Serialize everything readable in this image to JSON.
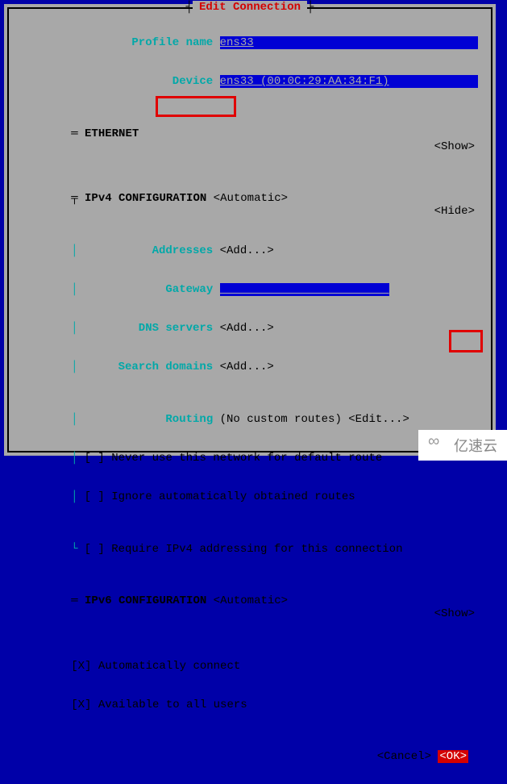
{
  "dialog": {
    "title": "Edit Connection"
  },
  "profile": {
    "label_name": "Profile name",
    "name_value": "ens33",
    "label_device": "Device",
    "device_value": "ens33 (00:0C:29:AA:34:F1)"
  },
  "ethernet": {
    "prefix": "═",
    "heading": "ETHERNET",
    "toggle": "<Show>"
  },
  "ipv4": {
    "bullet": "╤",
    "heading": "IPv4 CONFIGURATION",
    "mode": "<Automatic>",
    "toggle": "<Hide>",
    "addresses_label": "Addresses",
    "addresses_value": "<Add...>",
    "gateway_label": "Gateway",
    "gateway_value": "_________________________",
    "dns_label": "DNS servers",
    "dns_value": "<Add...>",
    "search_label": "Search domains",
    "search_value": "<Add...>",
    "routing_label": "Routing",
    "routing_value": "(No custom routes) <Edit...>",
    "chk_never_default": "[ ] Never use this network for default route",
    "chk_ignore_auto": "[ ] Ignore automatically obtained routes",
    "chk_require_v4": "[ ] Require IPv4 addressing for this connection"
  },
  "ipv6": {
    "prefix": "═",
    "heading": "IPv6 CONFIGURATION",
    "mode": "<Automatic>",
    "toggle": "<Show>"
  },
  "general": {
    "chk_auto_connect": "[X] Automatically connect",
    "chk_all_users": "[X] Available to all users"
  },
  "buttons": {
    "cancel": "<Cancel>",
    "ok": "<OK>"
  },
  "watermark": {
    "text": "亿速云"
  }
}
